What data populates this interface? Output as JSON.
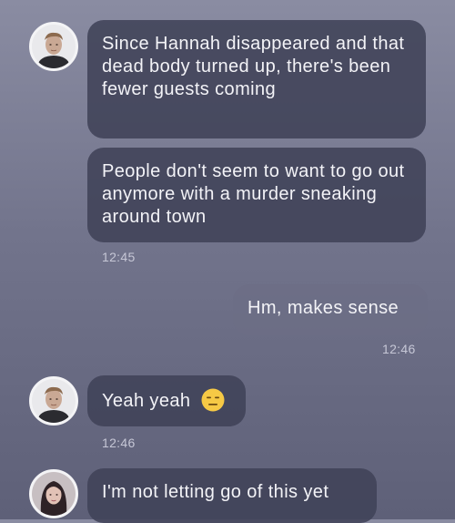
{
  "messages": [
    {
      "text": "Since Hannah disappeared and that dead body turned up, there's been fewer guests coming"
    },
    {
      "text": "People don't seem to want to go out anymore with a murder sneaking around town",
      "time": "12:45"
    },
    {
      "text": "Hm, makes sense",
      "time": "12:46"
    },
    {
      "text": "Yeah yeah",
      "emoji": "expressionless-face-icon",
      "time": "12:46"
    },
    {
      "text": "I'm not letting go of this yet"
    }
  ],
  "colors": {
    "incoming_bubble": "#404258",
    "outgoing_bubble": "#6c6e86",
    "text": "#f3f3f7",
    "timestamp": "#c6c7d6",
    "emoji_face": "#f6c945"
  }
}
